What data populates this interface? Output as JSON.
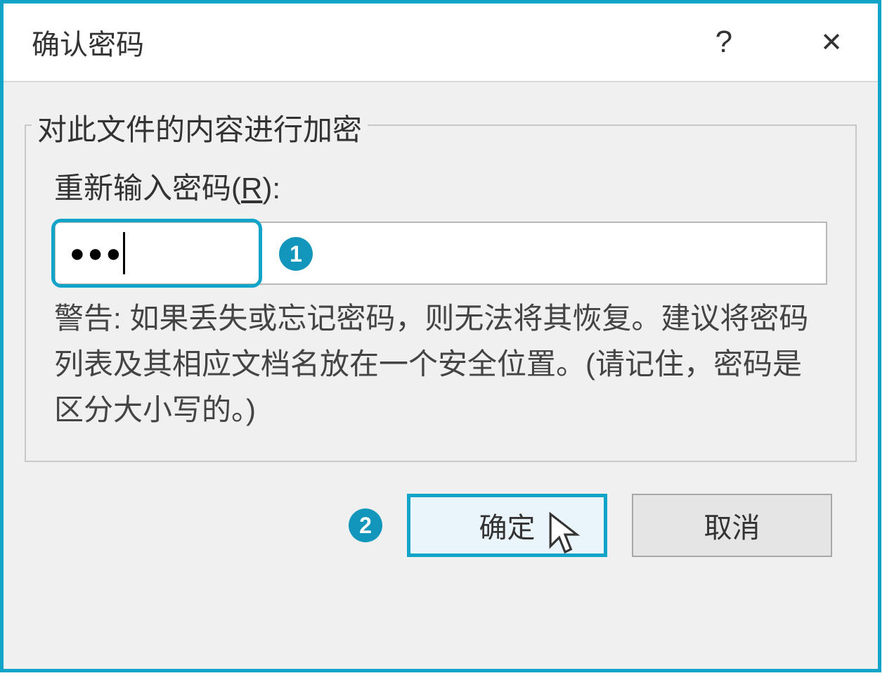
{
  "dialog": {
    "title": "确认密码",
    "help_tooltip": "?",
    "close_tooltip": "✕"
  },
  "groupbox": {
    "title": "对此文件的内容进行加密",
    "label_prefix": "重新输入密码(",
    "label_hotkey": "R",
    "label_suffix": "):",
    "password_value": "●●●",
    "warning": "警告: 如果丢失或忘记密码，则无法将其恢复。建议将密码列表及其相应文档名放在一个安全位置。(请记住，密码是区分大小写的。)"
  },
  "annotations": {
    "badge1": "1",
    "badge2": "2"
  },
  "buttons": {
    "ok": "确定",
    "cancel": "取消"
  }
}
